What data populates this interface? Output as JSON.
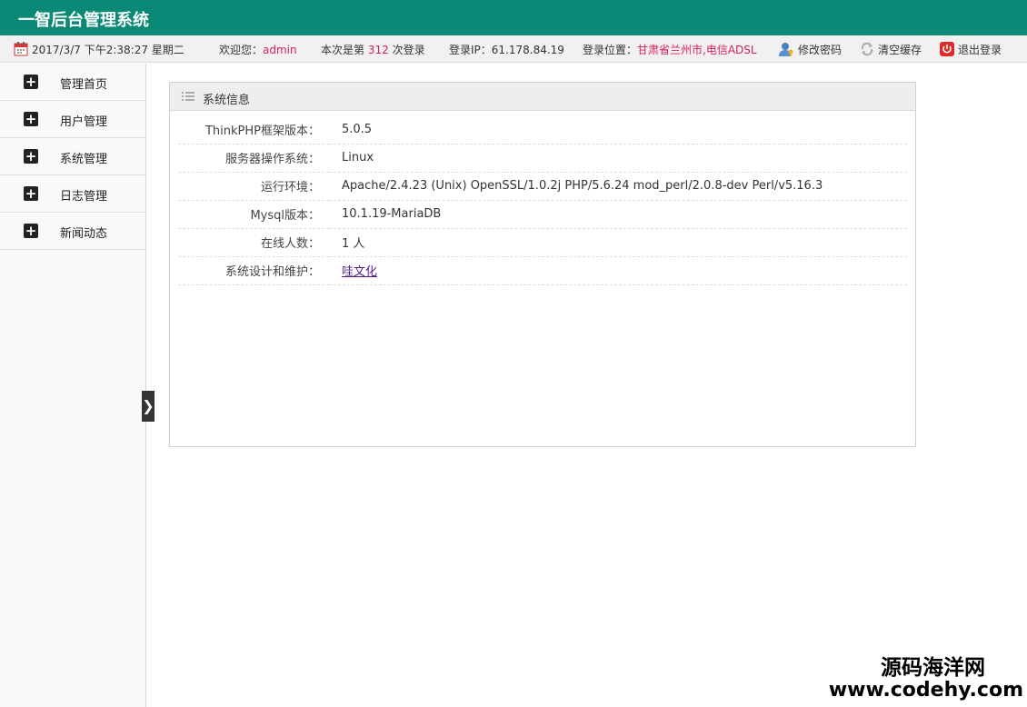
{
  "app": {
    "title": "一智后台管理系统"
  },
  "infobar": {
    "datetime": "2017/3/7 下午2:38:27 星期二",
    "welcome_prefix": "欢迎您：",
    "username": "admin",
    "login_count_prefix": "本次是第",
    "login_count": "312",
    "login_count_suffix": "次登录",
    "ip": "登录IP：61.178.84.19",
    "location_prefix": "登录位置：",
    "location": "甘肃省兰州市,电信ADSL",
    "change_password": "修改密码",
    "clear_cache": "清空缓存",
    "logout": "退出登录"
  },
  "sidebar": {
    "items": [
      {
        "label": "管理首页"
      },
      {
        "label": "用户管理"
      },
      {
        "label": "系统管理"
      },
      {
        "label": "日志管理"
      },
      {
        "label": "新闻动态"
      }
    ]
  },
  "collapse": {
    "glyph": "❯"
  },
  "panel": {
    "title": "系统信息",
    "rows": [
      {
        "key": "ThinkPHP框架版本：",
        "value": "5.0.5"
      },
      {
        "key": "服务器操作系统：",
        "value": "Linux"
      },
      {
        "key": "运行环境：",
        "value": "Apache/2.4.23 (Unix) OpenSSL/1.0.2j PHP/5.6.24 mod_perl/2.0.8-dev Perl/v5.16.3"
      },
      {
        "key": "Mysql版本：",
        "value": "10.1.19-MariaDB"
      },
      {
        "key": "在线人数：",
        "value": "1 人"
      },
      {
        "key": "系统设计和维护：",
        "value": "哇文化"
      }
    ]
  },
  "watermark": {
    "name": "源码海洋网",
    "url": "www.codehy.com"
  },
  "colors": {
    "header": "#0a8a76",
    "accent_red": "#d81e5a",
    "link": "#551a8b",
    "green_label": "#1a7a1a"
  }
}
